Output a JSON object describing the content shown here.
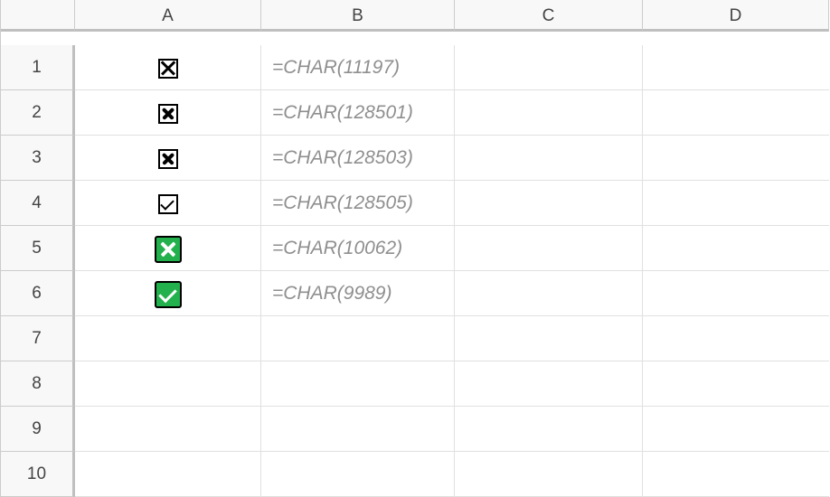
{
  "columns": [
    "A",
    "B",
    "C",
    "D"
  ],
  "row_numbers": [
    "1",
    "2",
    "3",
    "4",
    "5",
    "6",
    "7",
    "8",
    "9",
    "10"
  ],
  "cells": {
    "A1": {
      "icon": "box-x"
    },
    "B1": "=CHAR(11197)",
    "A2": {
      "icon": "box-x-bold"
    },
    "B2": "=CHAR(128501)",
    "A3": {
      "icon": "box-x-bold"
    },
    "B3": "=CHAR(128503)",
    "A4": {
      "icon": "box-check"
    },
    "B4": "=CHAR(128505)",
    "A5": {
      "icon": "green-x"
    },
    "B5": "=CHAR(10062)",
    "A6": {
      "icon": "green-check"
    },
    "B6": "=CHAR(9989)"
  }
}
